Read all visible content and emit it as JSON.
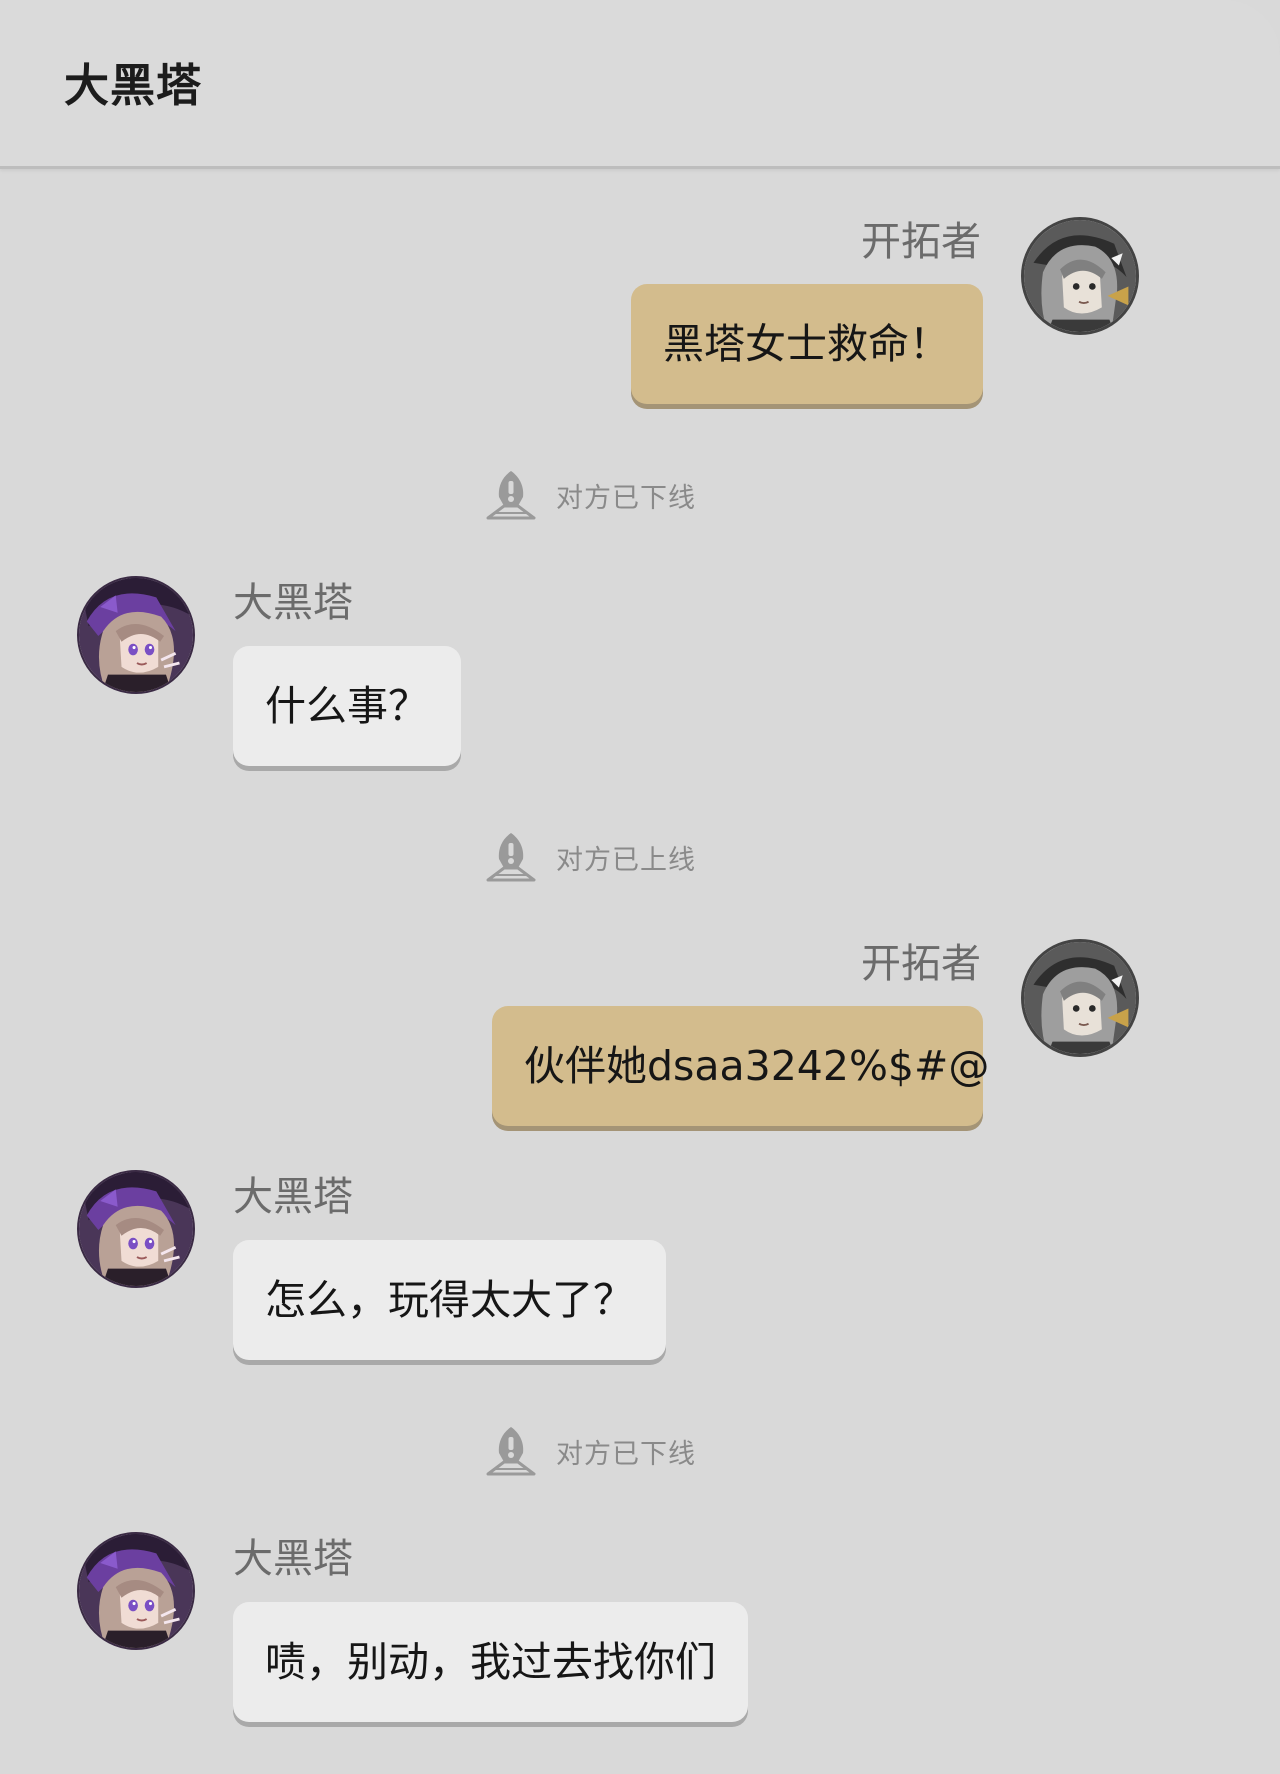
{
  "header": {
    "title": "大黑塔"
  },
  "messages": [
    {
      "type": "message",
      "side": "right",
      "sender": "开拓者",
      "text": "黑塔女士救命！"
    },
    {
      "type": "status",
      "icon": "warning-beacon-icon",
      "text": "对方已下线"
    },
    {
      "type": "message",
      "side": "left",
      "sender": "大黑塔",
      "text": "什么事？"
    },
    {
      "type": "status",
      "icon": "warning-beacon-icon",
      "text": "对方已上线"
    },
    {
      "type": "message",
      "side": "right",
      "sender": "开拓者",
      "text": "伙伴她dsaa3242%$#@"
    },
    {
      "type": "message",
      "side": "left",
      "sender": "大黑塔",
      "text": "怎么，玩得太大了？"
    },
    {
      "type": "status",
      "icon": "warning-beacon-icon",
      "text": "对方已下线"
    },
    {
      "type": "message",
      "side": "left",
      "sender": "大黑塔",
      "text": "啧，别动，我过去找你们"
    }
  ],
  "colors": {
    "background": "#d9d9d9",
    "my_bubble": "#d3bc8d",
    "other_bubble": "#ececec",
    "status_text": "#8a8a8a"
  }
}
